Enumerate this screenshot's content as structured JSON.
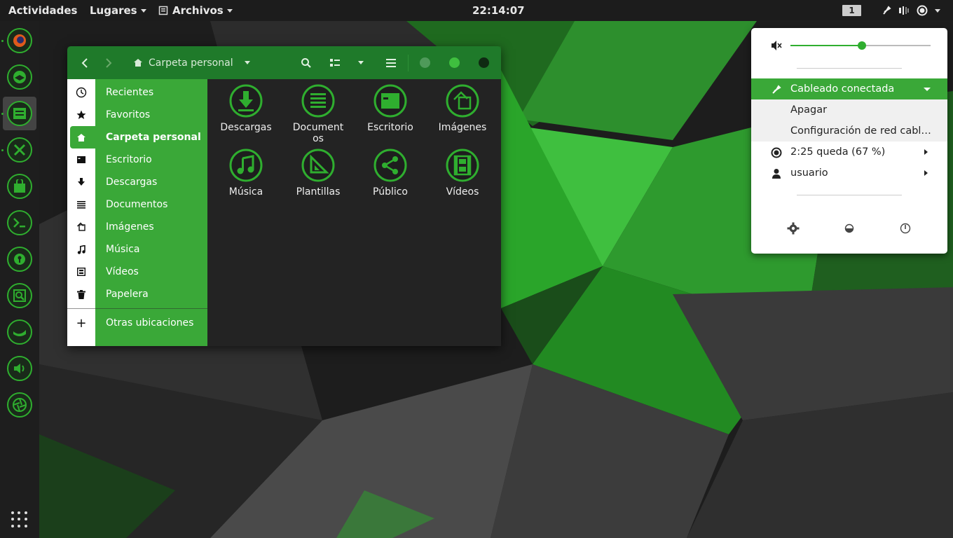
{
  "topbar": {
    "activities": "Actividades",
    "places": "Lugares",
    "app_menu": "Archivos",
    "clock": "22:14:07",
    "workspace": "1"
  },
  "dock": {
    "apps": [
      "firefox-icon",
      "thunderbird-icon",
      "files-icon",
      "tools-icon",
      "software-store-icon",
      "terminal-icon",
      "password-keyring-icon",
      "screenshot-viewer-icon",
      "genie-lamp-icon",
      "sound-icon",
      "camera-shutter-icon"
    ]
  },
  "file_manager": {
    "path_label": "Carpeta personal",
    "sidebar": [
      {
        "label": "Recientes",
        "icon": "clock-icon"
      },
      {
        "label": "Favoritos",
        "icon": "star-icon"
      },
      {
        "label": "Carpeta personal",
        "icon": "home-icon",
        "active": true
      },
      {
        "label": "Escritorio",
        "icon": "desktop-icon"
      },
      {
        "label": "Descargas",
        "icon": "download-icon"
      },
      {
        "label": "Documentos",
        "icon": "document-icon"
      },
      {
        "label": "Imágenes",
        "icon": "pictures-icon"
      },
      {
        "label": "Música",
        "icon": "music-icon"
      },
      {
        "label": "Vídeos",
        "icon": "video-icon"
      },
      {
        "label": "Papelera",
        "icon": "trash-icon"
      }
    ],
    "other_locations": "Otras ubicaciones",
    "folders": [
      {
        "label": "Descargas",
        "icon": "download-folder-icon"
      },
      {
        "label": "Documentos",
        "icon": "documents-folder-icon"
      },
      {
        "label": "Escritorio",
        "icon": "desktop-folder-icon"
      },
      {
        "label": "Imágenes",
        "icon": "pictures-folder-icon"
      },
      {
        "label": "Música",
        "icon": "music-folder-icon"
      },
      {
        "label": "Plantillas",
        "icon": "templates-folder-icon"
      },
      {
        "label": "Público",
        "icon": "public-folder-icon"
      },
      {
        "label": "Vídeos",
        "icon": "videos-folder-icon"
      }
    ]
  },
  "system_menu": {
    "volume_level": 0.51,
    "network_label": "Cableado conectada",
    "network_off": "Apagar",
    "network_settings": "Configuración de red cabl…",
    "battery_label": "2:25 queda (67 %)",
    "user_label": "usuario"
  },
  "colors": {
    "accent": "#2fae2f",
    "header": "#1f7a2a",
    "sidebar": "#3aa838",
    "content_bg": "#232323"
  }
}
